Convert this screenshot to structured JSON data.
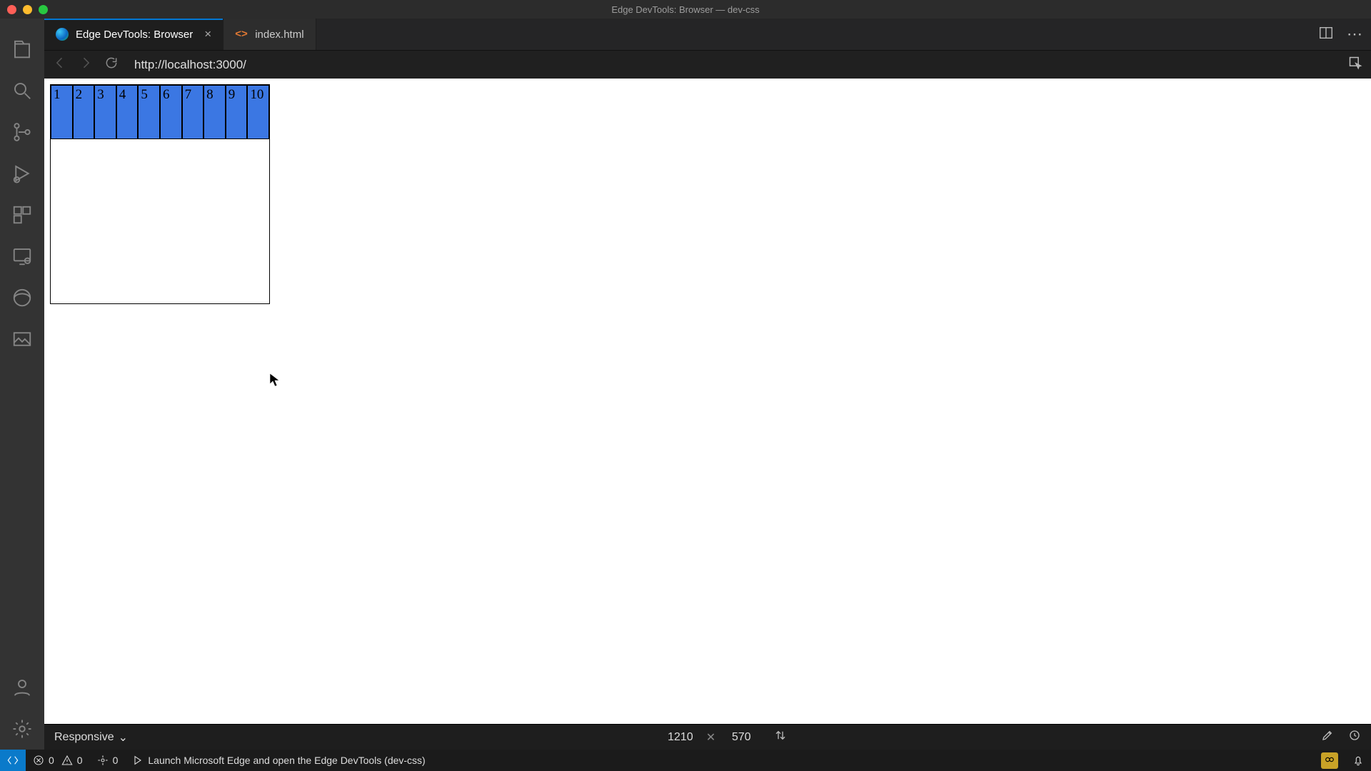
{
  "window": {
    "title": "Edge DevTools: Browser — dev-css"
  },
  "tabs": {
    "active": {
      "label": "Edge DevTools: Browser"
    },
    "other": {
      "label": "index.html"
    }
  },
  "toolbar": {
    "url": "http://localhost:3000/"
  },
  "page": {
    "grid_cells": [
      "1",
      "2",
      "3",
      "4",
      "5",
      "6",
      "7",
      "8",
      "9",
      "10"
    ]
  },
  "device": {
    "mode": "Responsive",
    "width": "1210",
    "height": "570"
  },
  "status": {
    "errors": "0",
    "warnings": "0",
    "ports": "0",
    "launch": "Launch Microsoft Edge and open the Edge DevTools (dev-css)"
  },
  "icons": {
    "close_glyph": "×",
    "times_glyph": "✕",
    "html_glyph": "<>",
    "ellipsis": "⋯",
    "chevron": "⌄"
  }
}
